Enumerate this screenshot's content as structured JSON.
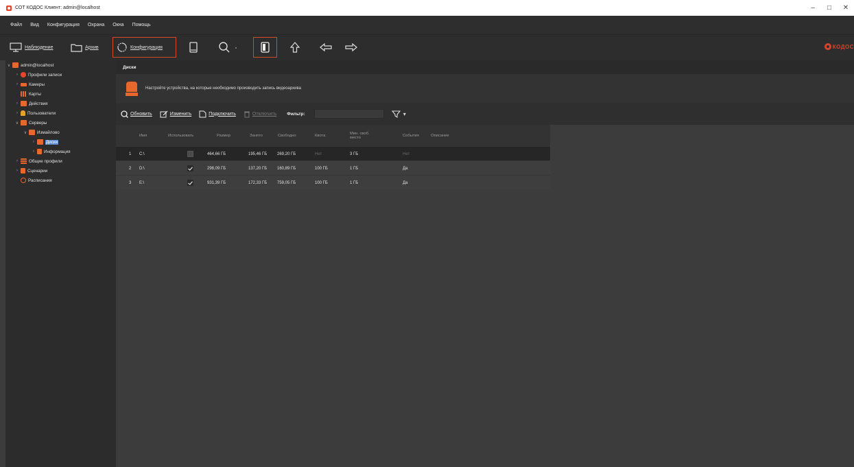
{
  "window": {
    "title": "СОТ КОДОС Клиент: admin@localhost",
    "controls": [
      "–",
      "□",
      "✕"
    ]
  },
  "menu": {
    "items": [
      "Файл",
      "Вид",
      "Конфигурация",
      "Охрана",
      "Окна",
      "Помощь"
    ]
  },
  "toolbar": {
    "observation_label": "Наблюдение",
    "archive_label": "Архив",
    "config_label": "Конфигурация",
    "search_dropdown": "·",
    "logo_text": "КОДОС"
  },
  "sidebar": {
    "items": [
      {
        "label": "admin@localhost",
        "arrow": "∨",
        "icon": "server-group-icon",
        "color": "#e8672c"
      },
      {
        "label": "Профили записи",
        "arrow": "›",
        "icon": "record-profile-icon",
        "color": "#e8462b"
      },
      {
        "label": "Камеры",
        "arrow": "›",
        "icon": "camera-icon",
        "color": "#e8672c"
      },
      {
        "label": "Карты",
        "arrow": "",
        "icon": "map-icon",
        "color": "#e8672c"
      },
      {
        "label": "Действия",
        "arrow": "›",
        "icon": "actions-icon",
        "color": "#e8672c"
      },
      {
        "label": "Пользователи",
        "arrow": "›",
        "icon": "users-icon",
        "color": "#e8a02c"
      },
      {
        "label": "Серверы",
        "arrow": "∨",
        "icon": "servers-icon",
        "color": "#e8672c"
      },
      {
        "label": "Измайлово",
        "arrow": "∨",
        "icon": "server-icon",
        "color": "#e8672c"
      },
      {
        "label": "Диски",
        "arrow": "›",
        "icon": "disk-icon",
        "color": "#e8672c"
      },
      {
        "label": "Информация",
        "arrow": "›",
        "icon": "info-icon",
        "color": "#e8672c"
      },
      {
        "label": "Общие профили",
        "arrow": "›",
        "icon": "profiles-icon",
        "color": "#e8672c"
      },
      {
        "label": "Сценарии",
        "arrow": "›",
        "icon": "scenarios-icon",
        "color": "#e8672c"
      },
      {
        "label": "Расписания",
        "arrow": "",
        "icon": "schedule-icon",
        "color": "#e8672c"
      }
    ]
  },
  "main": {
    "header": "Диски",
    "info_text": "Настройте устройства, на которые необходимо производить запись видеоархива",
    "actions": {
      "refresh": "Обновить",
      "edit": "Изменить",
      "connect": "Подключить",
      "disconnect": "Отключить",
      "filter_label": "Фильтр:",
      "filter_value": ""
    },
    "columns": [
      "Имя",
      "Использовать",
      "Размер",
      "Занято",
      "Свободно",
      "Квота",
      "Мин. своб. место",
      "События",
      "Описание"
    ],
    "rows": [
      {
        "n": "1",
        "name": "C:\\",
        "use": false,
        "size": "464,66 ГБ",
        "used": "195,46 ГБ",
        "free": "269,20 ГБ",
        "quota": "Нет",
        "min_free": "3 ГБ",
        "events": "Нет",
        "desc": ""
      },
      {
        "n": "2",
        "name": "D:\\",
        "use": true,
        "size": "298,09 ГБ",
        "used": "137,20 ГБ",
        "free": "160,89 ГБ",
        "quota": "100 ГБ",
        "min_free": "1 ГБ",
        "events": "Да",
        "desc": ""
      },
      {
        "n": "3",
        "name": "E:\\",
        "use": true,
        "size": "931,39 ГБ",
        "used": "172,33 ГБ",
        "free": "759,05 ГБ",
        "quota": "100 ГБ",
        "min_free": "1 ГБ",
        "events": "Да",
        "desc": ""
      }
    ]
  },
  "colors": {
    "accent": "#e8672c",
    "selection": "#5e8fd0"
  }
}
